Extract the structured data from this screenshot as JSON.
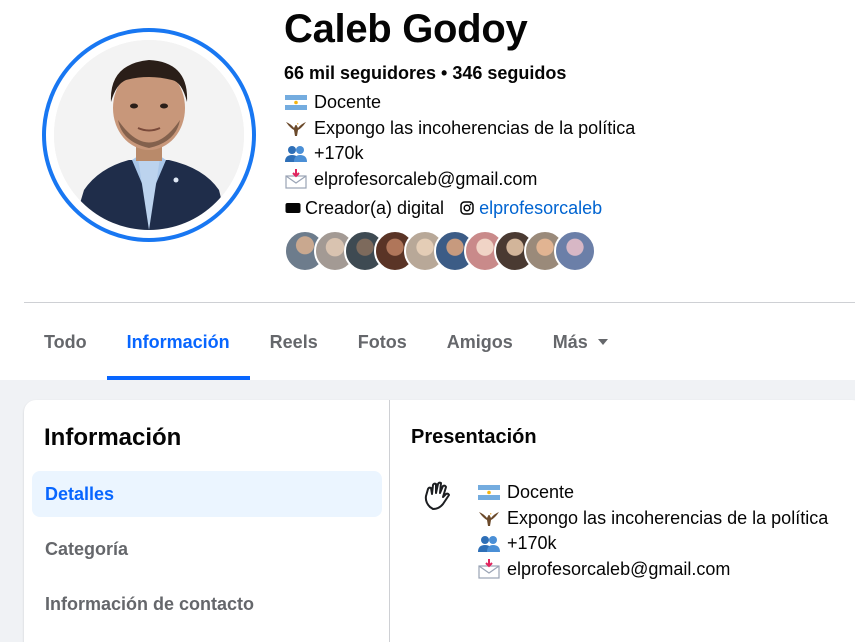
{
  "profile": {
    "name": "Caleb Godoy",
    "followers": "66 mil seguidores • 346 seguidos",
    "bio": [
      {
        "icon": "argentina-flag-icon",
        "text": "Docente"
      },
      {
        "icon": "eagle-icon",
        "text": "Expongo las incoherencias de la política"
      },
      {
        "icon": "people-icon",
        "text": "+170k"
      },
      {
        "icon": "envelope-arrow-icon",
        "text": "elprofesorcaleb@gmail.com"
      }
    ],
    "category": "Creador(a) digital",
    "instagram": "elprofesorcaleb",
    "accent": "#1877f2"
  },
  "tabs": [
    "Todo",
    "Información",
    "Reels",
    "Fotos",
    "Amigos",
    "Más"
  ],
  "active_tab": "Información",
  "about": {
    "title": "Información",
    "menu": [
      "Detalles",
      "Categoría",
      "Información de contacto"
    ],
    "active_menu": "Detalles",
    "section_title": "Presentación",
    "section_icon": "waving-hand-icon",
    "lines": [
      {
        "icon": "argentina-flag-icon",
        "text": "Docente"
      },
      {
        "icon": "eagle-icon",
        "text": "Expongo las incoherencias de la política"
      },
      {
        "icon": "people-icon",
        "text": "+170k"
      },
      {
        "icon": "envelope-arrow-icon",
        "text": "elprofesorcaleb@gmail.com"
      }
    ]
  },
  "colors": {
    "link": "#0064d1",
    "active": "#0866ff",
    "muted": "#65676b",
    "bg": "#f0f2f5"
  }
}
